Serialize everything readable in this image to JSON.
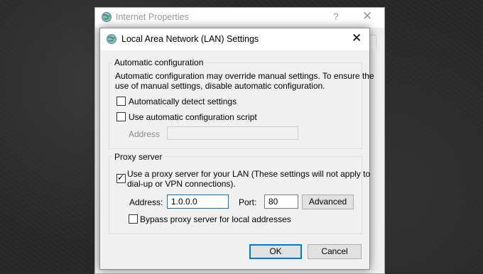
{
  "background_window": {
    "title": "Internet Properties",
    "help_glyph": "?",
    "close_glyph": "✕"
  },
  "dialog": {
    "title": "Local Area Network (LAN) Settings",
    "close_glyph": "✕",
    "auto_config": {
      "legend": "Automatic configuration",
      "description_line1": "Automatic configuration may override manual settings.  To ensure the",
      "description_line2": "use of manual settings, disable automatic configuration.",
      "detect_label": "Automatically detect settings",
      "detect_checked": false,
      "script_label": "Use automatic configuration script",
      "script_checked": false,
      "address_label": "Address",
      "address_value": ""
    },
    "proxy": {
      "legend": "Proxy server",
      "use_proxy_line1": "Use a proxy server for your LAN (These settings will not apply to",
      "use_proxy_line2": "dial-up or VPN connections).",
      "use_proxy_checked": true,
      "address_label": "Address:",
      "address_value": "1.0.0.0",
      "port_label": "Port:",
      "port_value": "80",
      "advanced_label": "Advanced",
      "bypass_label": "Bypass proxy server for local addresses",
      "bypass_checked": false
    },
    "ok_label": "OK",
    "cancel_label": "Cancel"
  },
  "icons": {
    "window_icon": "globe-network-icon",
    "check_glyph": "✓"
  },
  "colors": {
    "accent": "#0078d7",
    "dialog_bg": "#f0f0f0",
    "titlebar_bg": "#ffffff"
  }
}
